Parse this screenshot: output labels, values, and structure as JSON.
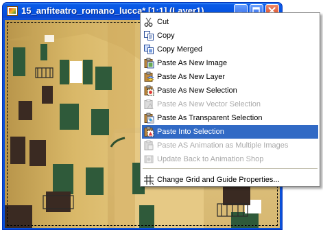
{
  "window": {
    "title": "15_anfiteatro_romano_lucca* [1:1] (Layer1)",
    "controls": [
      "minimize-icon",
      "maximize-icon",
      "close-icon"
    ]
  },
  "colors": {
    "titlebar": "#0553e1",
    "menu_highlight": "#316ac5",
    "facade_yellow": "#e3c47a",
    "shutter_green": "#2f5a3a",
    "sky_blue": "#3d6dc8"
  },
  "context_menu": {
    "items": [
      {
        "id": "cut",
        "label": "Cut",
        "icon": "scissors-icon",
        "enabled": true,
        "highlighted": false
      },
      {
        "id": "copy",
        "label": "Copy",
        "icon": "copy-icon",
        "enabled": true,
        "highlighted": false
      },
      {
        "id": "copy-merged",
        "label": "Copy Merged",
        "icon": "copy-merged-icon",
        "enabled": true,
        "highlighted": false
      },
      {
        "id": "paste-new-image",
        "label": "Paste As New Image",
        "icon": "paste-image-icon",
        "enabled": true,
        "highlighted": false
      },
      {
        "id": "paste-new-layer",
        "label": "Paste As New Layer",
        "icon": "paste-layer-icon",
        "enabled": true,
        "highlighted": false
      },
      {
        "id": "paste-new-selection",
        "label": "Paste As New Selection",
        "icon": "paste-selection-icon",
        "enabled": true,
        "highlighted": false
      },
      {
        "id": "paste-new-vector-selection",
        "label": "Paste As New Vector Selection",
        "icon": "paste-vector-icon",
        "enabled": false,
        "highlighted": false
      },
      {
        "id": "paste-transparent-selection",
        "label": "Paste As Transparent Selection",
        "icon": "paste-transparent-icon",
        "enabled": true,
        "highlighted": false
      },
      {
        "id": "paste-into-selection",
        "label": "Paste Into Selection",
        "icon": "paste-into-selection-icon",
        "enabled": true,
        "highlighted": true
      },
      {
        "id": "paste-animation",
        "label": "Paste AS Animation as Multiple Images",
        "icon": "paste-animation-icon",
        "enabled": false,
        "highlighted": false
      },
      {
        "id": "update-animation-shop",
        "label": "Update Back to Animation Shop",
        "icon": "animation-shop-icon",
        "enabled": false,
        "highlighted": false
      },
      {
        "id": "change-grid",
        "label": "Change Grid and Guide Properties...",
        "icon": "grid-icon",
        "enabled": true,
        "highlighted": false
      }
    ]
  }
}
